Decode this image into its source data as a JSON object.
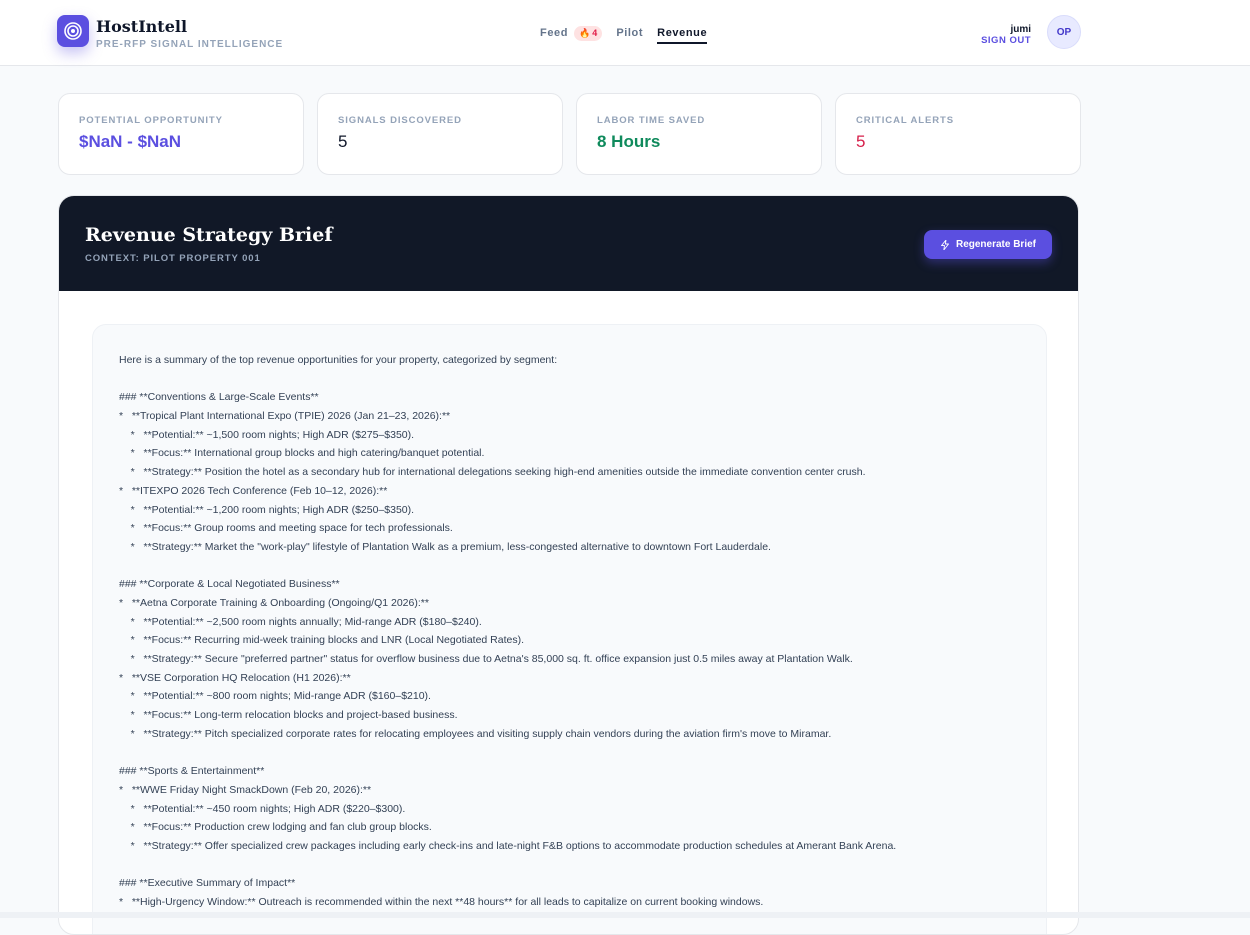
{
  "header": {
    "brand_name": "HostIntell",
    "brand_tagline": "PRE-RFP SIGNAL INTELLIGENCE",
    "nav": {
      "feed_label": "Feed",
      "feed_badge": "4",
      "pilot_label": "Pilot",
      "revenue_label": "Revenue",
      "active": "Revenue"
    },
    "user": {
      "name": "jumi",
      "sign_out": "SIGN OUT",
      "initials": "OP"
    }
  },
  "stats": [
    {
      "label": "POTENTIAL OPPORTUNITY",
      "value": "$NaN - $NaN"
    },
    {
      "label": "SIGNALS DISCOVERED",
      "value": "5"
    },
    {
      "label": "LABOR TIME SAVED",
      "value": "8 Hours"
    },
    {
      "label": "CRITICAL ALERTS",
      "value": "5"
    }
  ],
  "brief": {
    "title": "Revenue Strategy Brief",
    "context": "CONTEXT: PILOT PROPERTY 001",
    "regenerate_label": "Regenerate Brief",
    "lines": [
      "Here is a summary of the top revenue opportunities for your property, categorized by segment:",
      "",
      "### **Conventions & Large-Scale Events**",
      "*   **Tropical Plant International Expo (TPIE) 2026 (Jan 21–23, 2026):**",
      "    *   **Potential:** ~1,500 room nights; High ADR ($275–$350).",
      "    *   **Focus:** International group blocks and high catering/banquet potential.",
      "    *   **Strategy:** Position the hotel as a secondary hub for international delegations seeking high-end amenities outside the immediate convention center crush.",
      "*   **ITEXPO 2026 Tech Conference (Feb 10–12, 2026):**",
      "    *   **Potential:** ~1,200 room nights; High ADR ($250–$350).",
      "    *   **Focus:** Group rooms and meeting space for tech professionals.",
      "    *   **Strategy:** Market the \"work-play\" lifestyle of Plantation Walk as a premium, less-congested alternative to downtown Fort Lauderdale.",
      "",
      "### **Corporate & Local Negotiated Business**",
      "*   **Aetna Corporate Training & Onboarding (Ongoing/Q1 2026):**",
      "    *   **Potential:** ~2,500 room nights annually; Mid-range ADR ($180–$240).",
      "    *   **Focus:** Recurring mid-week training blocks and LNR (Local Negotiated Rates).",
      "    *   **Strategy:** Secure \"preferred partner\" status for overflow business due to Aetna's 85,000 sq. ft. office expansion just 0.5 miles away at Plantation Walk.",
      "*   **VSE Corporation HQ Relocation (H1 2026):**",
      "    *   **Potential:** ~800 room nights; Mid-range ADR ($160–$210).",
      "    *   **Focus:** Long-term relocation blocks and project-based business.",
      "    *   **Strategy:** Pitch specialized corporate rates for relocating employees and visiting supply chain vendors during the aviation firm's move to Miramar.",
      "",
      "### **Sports & Entertainment**",
      "*   **WWE Friday Night SmackDown (Feb 20, 2026):**",
      "    *   **Potential:** ~450 room nights; High ADR ($220–$300).",
      "    *   **Focus:** Production crew lodging and fan club group blocks.",
      "    *   **Strategy:** Offer specialized crew packages including early check-ins and late-night F&B options to accommodate production schedules at Amerant Bank Arena.",
      "",
      "### **Executive Summary of Impact**",
      "*   **High-Urgency Window:** Outreach is recommended within the next **48 hours** for all leads to capitalize on current booking windows."
    ]
  }
}
